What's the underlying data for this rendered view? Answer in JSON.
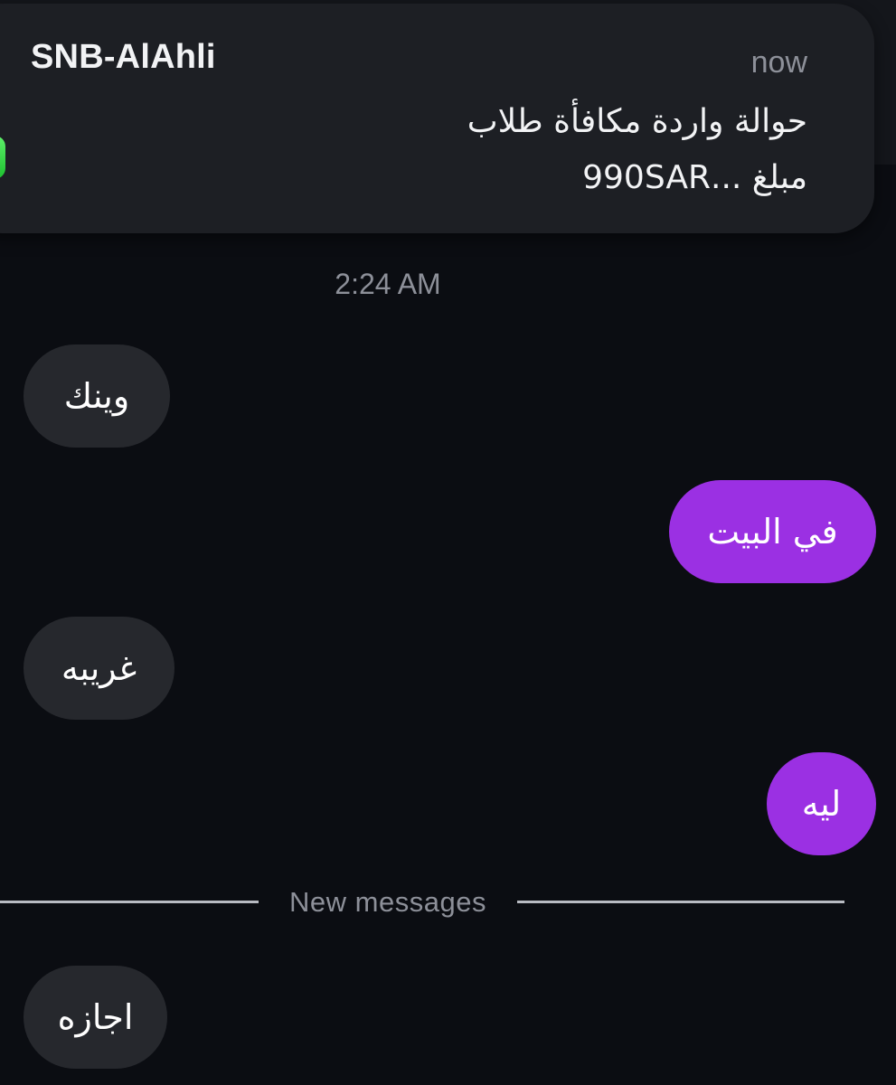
{
  "notification": {
    "sender": "SNB-AlAhli",
    "time": "now",
    "preview_line1": "حوالة واردة مكافأة طلاب",
    "preview_line2": "مبلغ ...990SAR",
    "app_icon": "messages-icon",
    "badge_color": "#2bd13c"
  },
  "conversation": {
    "timestamp": "2:24 AM",
    "messages": [
      {
        "direction": "incoming",
        "text": "وينك"
      },
      {
        "direction": "outgoing",
        "text": "في البيت"
      },
      {
        "direction": "incoming",
        "text": "غريبه"
      },
      {
        "direction": "outgoing",
        "text": "ليه"
      },
      {
        "direction": "incoming",
        "text": "اجازه"
      }
    ],
    "new_messages_label": "New messages"
  },
  "colors": {
    "background": "#0b0d12",
    "incoming_bubble": "#26282d",
    "outgoing_bubble": "#9b30e3"
  }
}
